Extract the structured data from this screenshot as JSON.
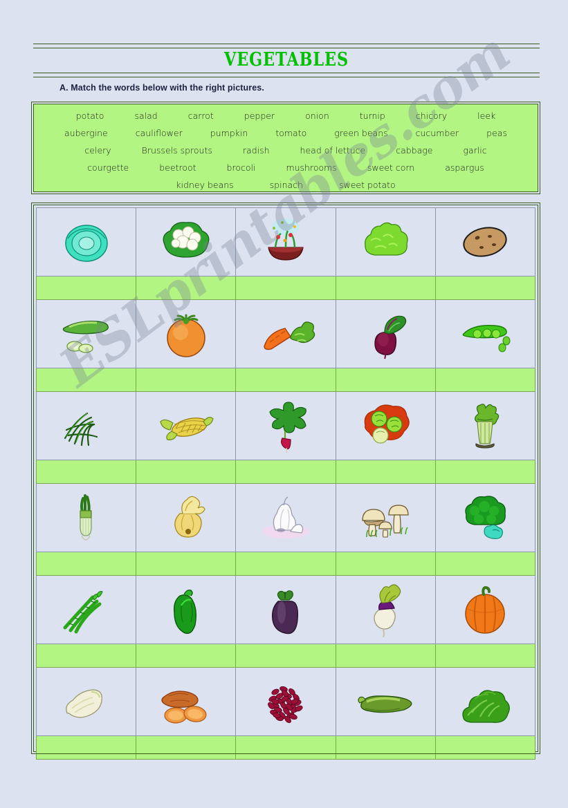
{
  "document": {
    "title": "VEGETABLES",
    "instruction": "A. Match the words below with the right pictures.",
    "watermark": "ESLprintables.com"
  },
  "colors": {
    "page_background": "#dde2f0",
    "rule_green": "#3a5a20",
    "title_green": "#00c000",
    "wordbank_fill": "#b2f582",
    "answer_row_fill": "#b2f582",
    "cell_border": "#8e96ad",
    "instruction_text": "#1c2340"
  },
  "wordbank": {
    "rows": [
      [
        "potato",
        "salad",
        "carrot",
        "pepper",
        "onion",
        "turnip",
        "chicory",
        "leek"
      ],
      [
        "aubergine",
        "cauliflower",
        "pumpkin",
        "tomato",
        "green beans",
        "cucumber",
        "peas"
      ],
      [
        "celery",
        "Brussels sprouts",
        "radish",
        "head of lettuce",
        "cabbage",
        "garlic"
      ],
      [
        "courgette",
        "beetroot",
        "brocoli",
        "mushrooms",
        "sweet corn",
        "aspargus"
      ],
      [
        "kidney beans",
        "spinach",
        "sweet potato"
      ]
    ]
  },
  "grid": {
    "columns": 5,
    "rows": [
      {
        "pictures": [
          {
            "name": "cabbage",
            "icon": "cabbage-icon"
          },
          {
            "name": "cauliflower",
            "icon": "cauliflower-icon"
          },
          {
            "name": "salad",
            "icon": "salad-bowl-icon"
          },
          {
            "name": "head of lettuce",
            "icon": "lettuce-icon"
          },
          {
            "name": "potato",
            "icon": "potato-icon"
          }
        ],
        "answers": [
          "",
          "",
          "",
          "",
          ""
        ]
      },
      {
        "pictures": [
          {
            "name": "cucumber",
            "icon": "cucumber-icon"
          },
          {
            "name": "tomato",
            "icon": "tomato-icon"
          },
          {
            "name": "carrot",
            "icon": "carrot-icon"
          },
          {
            "name": "beetroot",
            "icon": "beetroot-icon"
          },
          {
            "name": "peas",
            "icon": "peas-icon"
          }
        ],
        "answers": [
          "",
          "",
          "",
          "",
          ""
        ]
      },
      {
        "pictures": [
          {
            "name": "green beans",
            "icon": "green-beans-icon"
          },
          {
            "name": "sweet corn",
            "icon": "sweet-corn-icon"
          },
          {
            "name": "radish",
            "icon": "radish-icon"
          },
          {
            "name": "Brussels sprouts",
            "icon": "brussels-sprouts-icon"
          },
          {
            "name": "celery",
            "icon": "celery-icon"
          }
        ],
        "answers": [
          "",
          "",
          "",
          "",
          ""
        ]
      },
      {
        "pictures": [
          {
            "name": "leek",
            "icon": "leek-icon"
          },
          {
            "name": "onion",
            "icon": "onion-icon"
          },
          {
            "name": "garlic",
            "icon": "garlic-icon"
          },
          {
            "name": "mushrooms",
            "icon": "mushrooms-icon"
          },
          {
            "name": "brocoli",
            "icon": "brocoli-icon"
          }
        ],
        "answers": [
          "",
          "",
          "",
          "",
          ""
        ]
      },
      {
        "pictures": [
          {
            "name": "aspargus",
            "icon": "asparagus-icon"
          },
          {
            "name": "pepper",
            "icon": "pepper-icon"
          },
          {
            "name": "aubergine",
            "icon": "aubergine-icon"
          },
          {
            "name": "turnip",
            "icon": "turnip-icon"
          },
          {
            "name": "pumpkin",
            "icon": "pumpkin-icon"
          }
        ],
        "answers": [
          "",
          "",
          "",
          "",
          ""
        ]
      },
      {
        "pictures": [
          {
            "name": "chicory",
            "icon": "chicory-icon"
          },
          {
            "name": "sweet potato",
            "icon": "sweet-potato-icon"
          },
          {
            "name": "kidney beans",
            "icon": "kidney-beans-icon"
          },
          {
            "name": "courgette",
            "icon": "courgette-icon"
          },
          {
            "name": "spinach",
            "icon": "spinach-icon"
          }
        ],
        "answers": [
          "",
          "",
          "",
          "",
          ""
        ]
      }
    ]
  }
}
